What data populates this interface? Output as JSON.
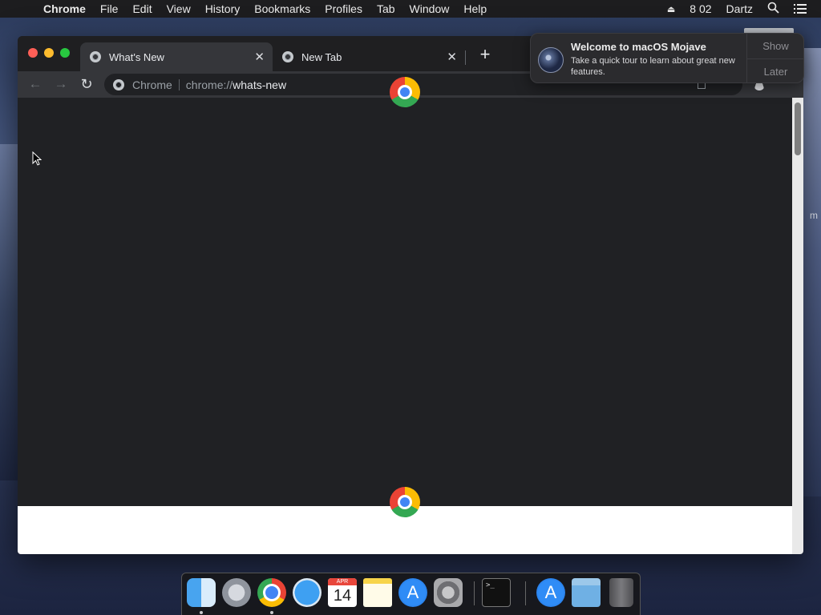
{
  "menubar": {
    "app_name": "Chrome",
    "items": [
      "File",
      "Edit",
      "View",
      "History",
      "Bookmarks",
      "Profiles",
      "Tab",
      "Window",
      "Help"
    ],
    "clock": "8 02",
    "user": "Dartz"
  },
  "browser": {
    "tabs": [
      {
        "title": "What's New",
        "active": true
      },
      {
        "title": "New Tab",
        "active": false
      }
    ],
    "omnibox": {
      "chip": "Chrome",
      "url_scheme": "chrome://",
      "url_host": "whats-new"
    }
  },
  "notification": {
    "title": "Welcome to macOS Mojave",
    "body": "Take a quick tour to learn about great new features.",
    "show_label": "Show",
    "later_label": "Later"
  },
  "desktop": {
    "fragment_text": "m"
  },
  "dock": {
    "calendar_month": "APR",
    "calendar_day": "14",
    "terminal_prompt": ">_",
    "items": [
      "finder-icon",
      "launchpad-icon",
      "chrome-icon",
      "safari-icon",
      "calendar-icon",
      "notes-icon",
      "app-store-icon",
      "system-preferences-icon",
      "terminal-icon",
      "app-store-icon",
      "downloads-folder-icon",
      "trash-icon"
    ]
  },
  "colors": {
    "menubar": "#1d1d1f",
    "window_bg": "#202124",
    "toolbar": "#35363a",
    "chrome_red": "#ea4335",
    "chrome_yellow": "#fbbc04",
    "chrome_green": "#34a853",
    "chrome_blue": "#4285f4"
  }
}
